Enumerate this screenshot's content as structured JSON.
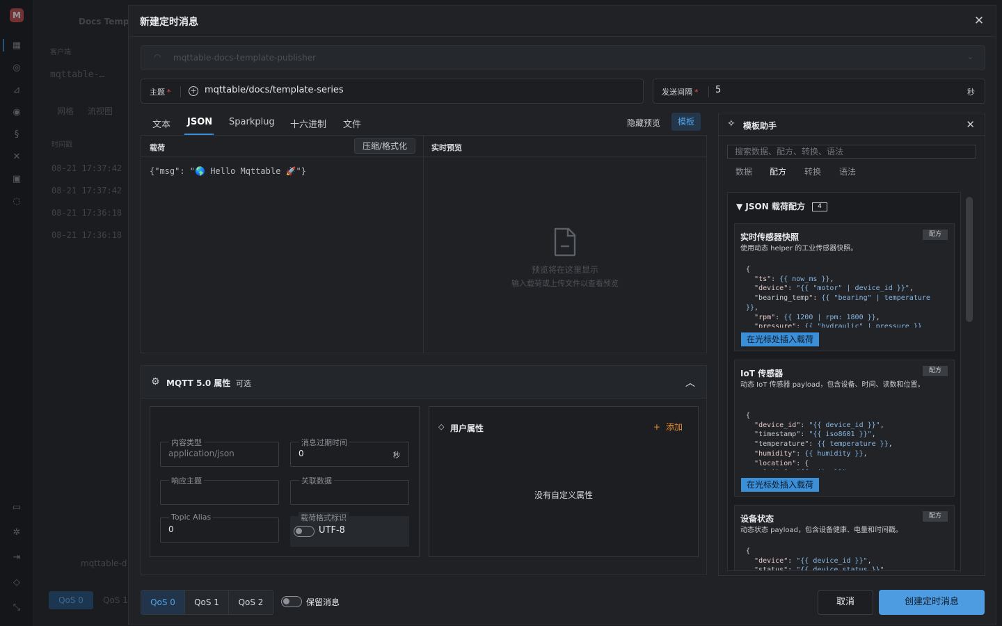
{
  "background": {
    "app_title": "Docs Templ",
    "section_label": "客户端",
    "client_name": "mqttable-…",
    "view_tabs": [
      "网格",
      "流视图"
    ],
    "time_header": "时间戳",
    "rows": [
      "08-21 17:37:42",
      "08-21 17:37:42",
      "08-21 17:36:18",
      "08-21 17:36:18"
    ],
    "bottom_conn": "mqttable-d",
    "qos0": "QoS 0",
    "qos1": "QoS 1"
  },
  "modal": {
    "title": "新建定时消息",
    "connection": "mqttable-docs-template-publisher",
    "topic": {
      "label": "主题",
      "value": "mqttable/docs/template-series"
    },
    "interval": {
      "label": "发送间隔",
      "value": "5",
      "unit": "秒"
    },
    "tabs": [
      "文本",
      "JSON",
      "Sparkplug",
      "十六进制",
      "文件"
    ],
    "active_tab": "JSON",
    "hide_preview": "隐藏预览",
    "template_btn": "模板",
    "editor": {
      "payload_label": "载荷",
      "format_btn": "压缩/格式化",
      "preview_label": "实时预览",
      "code": "{\"msg\": \"🌎 Hello Mqttable 🚀\"}",
      "preview_line1": "预览将在这里显示",
      "preview_line2": "输入载荷或上传文件以查看预览"
    },
    "mqtt5": {
      "title": "MQTT 5.0 属性",
      "optional": "可选",
      "content_type": {
        "label": "内容类型",
        "placeholder": "application/json"
      },
      "expiry": {
        "label": "消息过期时间",
        "value": "0",
        "unit": "秒"
      },
      "response_topic": {
        "label": "响应主题",
        "value": ""
      },
      "correlation": {
        "label": "关联数据",
        "value": ""
      },
      "topic_alias": {
        "label": "Topic Alias",
        "value": "0"
      },
      "payload_format": {
        "label": "载荷格式标识",
        "value": "UTF-8"
      },
      "user_props": {
        "title": "用户属性",
        "add": "添加",
        "empty": "没有自定义属性"
      }
    },
    "helper": {
      "title": "模板助手",
      "search_placeholder": "搜索数据、配方、转换、语法",
      "tabs": [
        "数据",
        "配方",
        "转换",
        "语法"
      ],
      "active_tab": "配方",
      "group_title": "JSON 载荷配方",
      "group_count": "4",
      "insert_label": "在光标处插入载荷",
      "cards": [
        {
          "title": "实时传感器快照",
          "tag": "配方",
          "desc": "使用动态 helper 的工业传感器快照。"
        },
        {
          "title": "IoT 传感器",
          "tag": "配方",
          "desc": "动态 IoT 传感器 payload，包含设备、时间、读数和位置。"
        },
        {
          "title": "设备状态",
          "tag": "配方",
          "desc": "动态状态 payload，包含设备健康、电量和时间戳。"
        }
      ]
    },
    "footer": {
      "qos": [
        "QoS 0",
        "QoS 1",
        "QoS 2"
      ],
      "active_qos": "QoS 0",
      "retain": "保留消息",
      "cancel": "取消",
      "create": "创建定时消息"
    }
  }
}
